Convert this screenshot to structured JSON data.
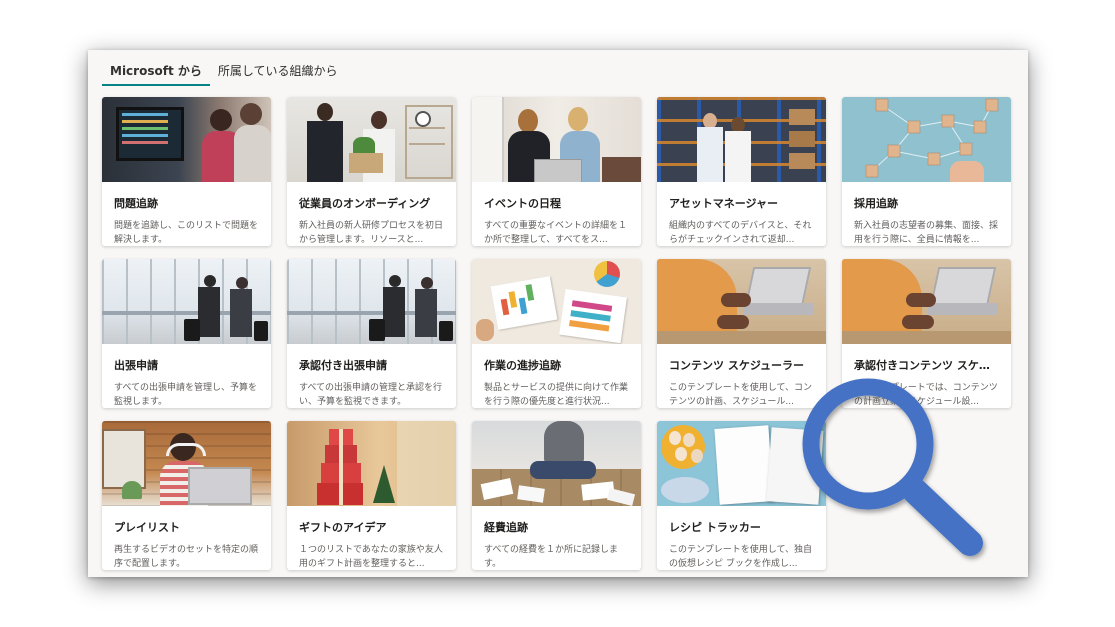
{
  "tabs": [
    {
      "label": "Microsoft から",
      "active": true
    },
    {
      "label": "所属している組織から",
      "active": false
    }
  ],
  "cards": [
    {
      "title": "問題追跡",
      "desc": "問題を追跡し、このリストで問題を解決します。",
      "icon": "developers-at-monitors-photo"
    },
    {
      "title": "従業員のオンボーディング",
      "desc": "新入社員の新人研修プロセスを初日から管理します。リソースと...",
      "icon": "office-handshake-photo"
    },
    {
      "title": "イベントの日程",
      "desc": "すべての重要なイベントの詳細を１か所で整理して、すべてをス...",
      "icon": "women-at-laptop-photo"
    },
    {
      "title": "アセットマネージャー",
      "desc": "組織内のすべてのデバイスと、それらがチェックインされて返却...",
      "icon": "warehouse-workers-photo"
    },
    {
      "title": "採用追跡",
      "desc": "新入社員の志望者の募集、面接、採用を行う際に、全員に情報を...",
      "icon": "people-network-blocks-photo"
    },
    {
      "title": "出張申請",
      "desc": "すべての出張申請を管理し、予算を監視します。",
      "icon": "airport-travelers-photo"
    },
    {
      "title": "承認付き出張申請",
      "desc": "すべての出張申請の管理と承認を行い、予算を監視できます。",
      "icon": "airport-travelers-photo"
    },
    {
      "title": "作業の進捗追跡",
      "desc": "製品とサービスの提供に向けて作業を行う際の優先度と進行状況...",
      "icon": "charts-on-desk-photo"
    },
    {
      "title": "コンテンツ スケジューラー",
      "desc": "このテンプレートを使用して、コンテンツの計画、スケジュール...",
      "icon": "laptop-hands-photo"
    },
    {
      "title": "承認付きコンテンツ スケジ...",
      "desc": "このテンプレートでは、コンテンツの計画立案、スケジュール設...",
      "icon": "laptop-hands-photo"
    },
    {
      "title": "プレイリスト",
      "desc": "再生するビデオのセットを特定の順序で配置します。",
      "icon": "woman-headphones-photo"
    },
    {
      "title": "ギフトのアイデア",
      "desc": "１つのリストであなたの家族や友人用のギフト計画を整理すると...",
      "icon": "gift-boxes-photo"
    },
    {
      "title": "経費追跡",
      "desc": "すべての経費を１か所に記録します。",
      "icon": "receipts-floor-photo"
    },
    {
      "title": "レシピ トラッカー",
      "desc": "このテンプレートを使用して、独自の仮想レシピ ブックを作成し...",
      "icon": "eggs-notebook-photo"
    }
  ],
  "colors": {
    "tab_underline": "#038387",
    "magnifier": "#4472c4"
  },
  "overlay": {
    "icon": "magnifying-glass-icon"
  }
}
